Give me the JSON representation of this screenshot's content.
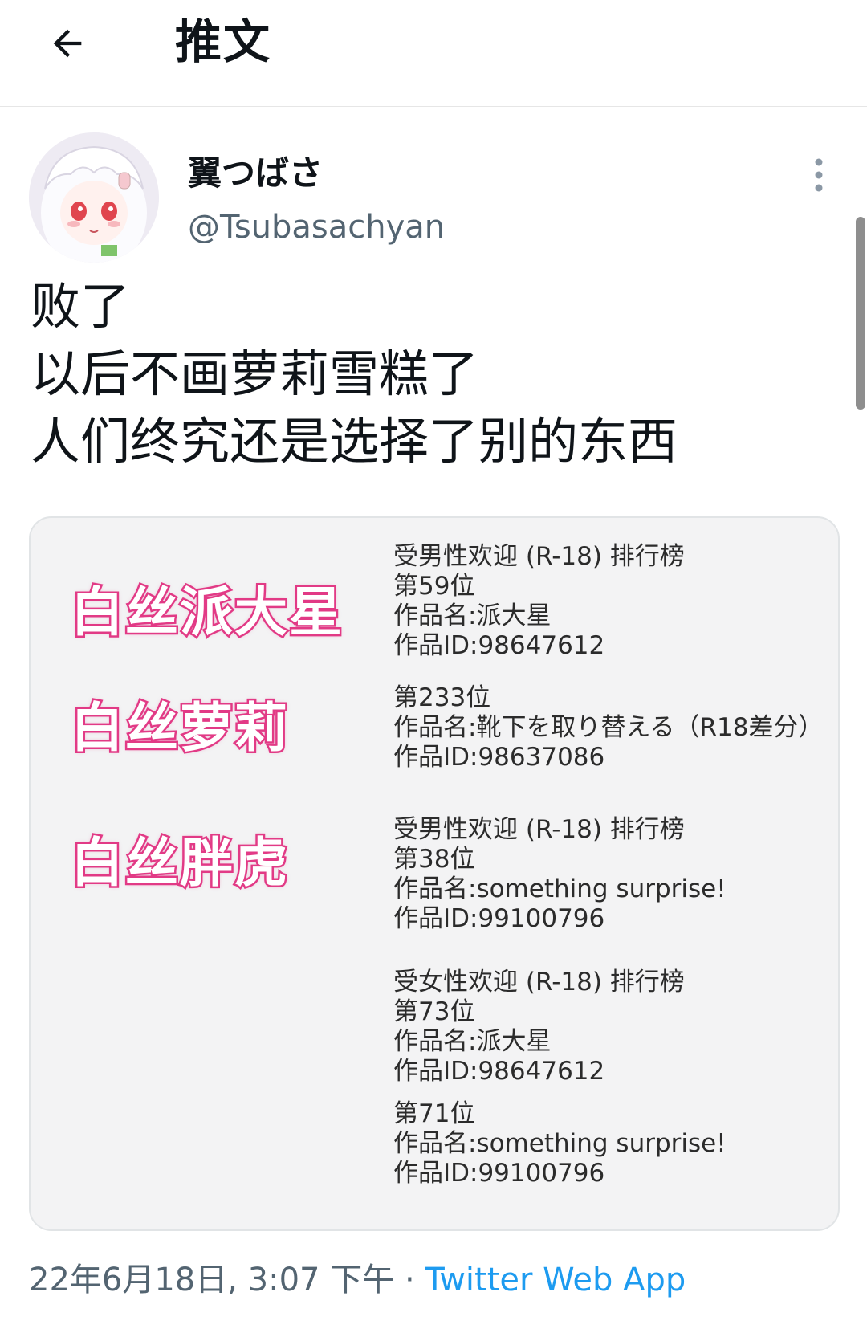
{
  "header": {
    "back_icon": "arrow-left-icon",
    "title": "推文"
  },
  "author": {
    "avatar_icon": "avatar-image",
    "display_name": "翼つばさ",
    "handle": "@Tsubasachyan",
    "more_icon": "more-vertical-icon"
  },
  "tweet": {
    "lines": [
      "败了",
      "以后不画萝莉雪糕了",
      "人们终究还是选择了别的东西"
    ]
  },
  "media": {
    "labels": [
      "白丝派大星",
      "白丝萝莉",
      "白丝胖虎"
    ],
    "blocks": [
      {
        "lines": [
          "受男性欢迎 (R-18) 排行榜",
          "第59位",
          "作品名:派大星",
          "作品ID:98647612"
        ]
      },
      {
        "lines": [
          "第233位",
          "作品名:靴下を取り替える（R18差分）",
          "作品ID:98637086"
        ]
      },
      {
        "lines": [
          "受男性欢迎 (R-18) 排行榜",
          "第38位",
          "作品名:something surprise!",
          "作品ID:99100796"
        ]
      },
      {
        "lines": [
          "受女性欢迎 (R-18) 排行榜",
          "第73位",
          "作品名:派大星",
          "作品ID:98647612"
        ]
      },
      {
        "lines": [
          "第71位",
          "作品名:something surprise!",
          "作品ID:99100796"
        ]
      }
    ]
  },
  "footer": {
    "timestamp": "22年6月18日, 3:07 下午",
    "separator": "·",
    "source": "Twitter Web App"
  },
  "colors": {
    "link": "#1d9bf0",
    "label_pink": "#e23b86",
    "muted": "#536471"
  }
}
